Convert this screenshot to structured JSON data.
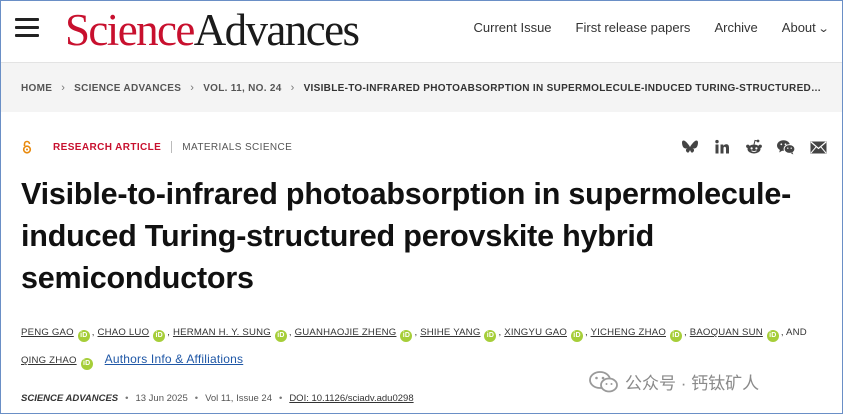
{
  "header": {
    "logo_part1": "Science",
    "logo_part2": "Advances",
    "nav": [
      "Current Issue",
      "First release papers",
      "Archive",
      "About"
    ]
  },
  "breadcrumb": [
    "HOME",
    "SCIENCE ADVANCES",
    "VOL. 11, NO. 24",
    "VISIBLE-TO-INFRARED PHOTOABSORPTION IN SUPERMOLECULE-INDUCED TURING-STRUCTURED…"
  ],
  "article": {
    "type": "RESEARCH ARTICLE",
    "subject": "MATERIALS SCIENCE",
    "title": "Visible-to-infrared photoabsorption in supermolecule-induced Turing-structured perovskite hybrid semiconductors",
    "authors": [
      "PENG GAO",
      "CHAO LUO",
      "HERMAN H. Y. SUNG",
      "GUANHAOJIE ZHENG",
      "SHIHE YANG",
      "XINGYU GAO",
      "YICHENG ZHAO",
      "BAOQUAN SUN",
      "QING ZHAO"
    ],
    "and_text": "AND",
    "affiliations_link": "Authors Info & Affiliations",
    "orcid_label": "iD",
    "journal": "SCIENCE ADVANCES",
    "date": "13 Jun 2025",
    "volume_issue": "Vol 11, Issue 24",
    "doi": "DOI: 10.1126/sciadv.adu0298"
  },
  "share_icons": [
    "bluesky-icon",
    "linkedin-icon",
    "reddit-icon",
    "wechat-icon",
    "email-icon"
  ],
  "watermark": {
    "text": "公众号 · 钙钛矿人"
  },
  "colors": {
    "brand_red": "#c8102e",
    "link_blue": "#1f57a6",
    "orcid_green": "#a6ce39",
    "open_access_orange": "#e8890c",
    "frame_border": "#6a8fc6"
  }
}
